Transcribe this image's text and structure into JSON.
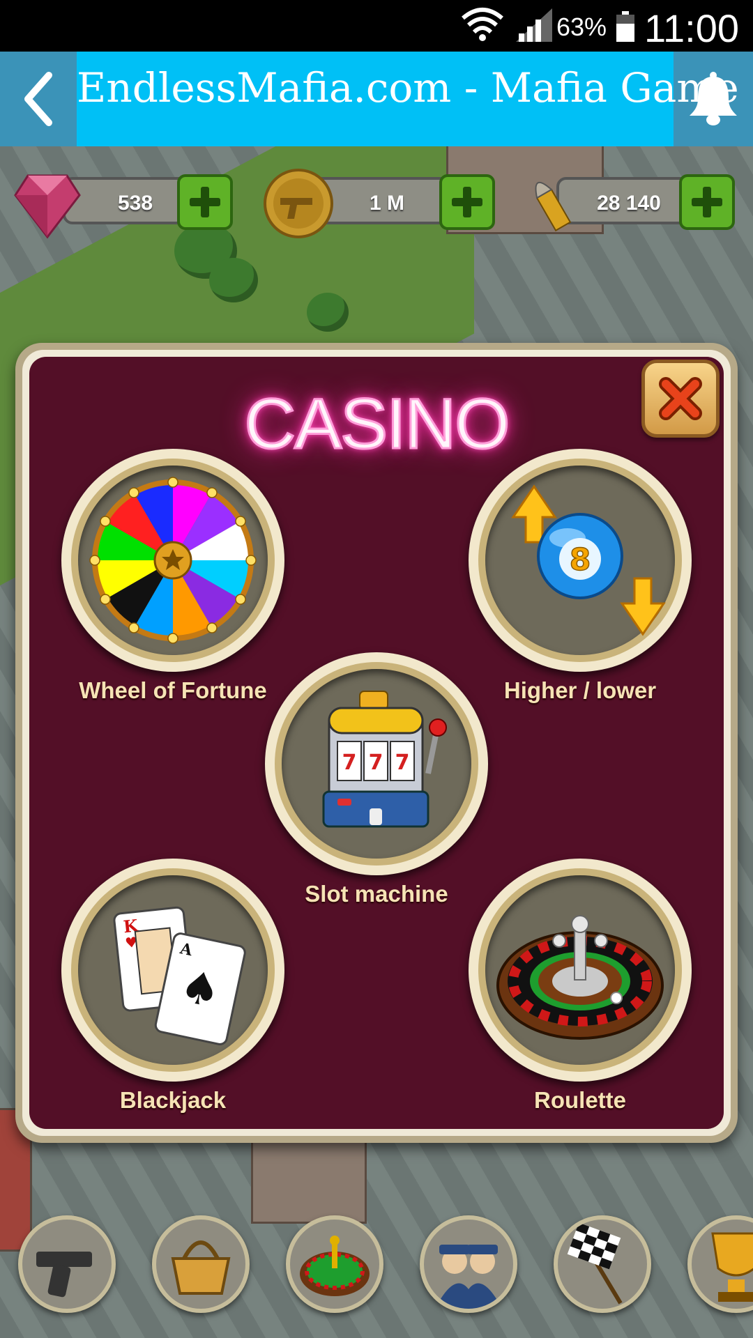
{
  "status_bar": {
    "battery": "63%",
    "time": "11:00"
  },
  "app_bar": {
    "title": "EndlessMafia.com - Mafia Game"
  },
  "resources": {
    "gems": "538",
    "cash": "1 M",
    "bullets": "28 140"
  },
  "casino": {
    "title": "CASINO",
    "games": {
      "wheel": "Wheel of Fortune",
      "higher_lower": "Higher / lower",
      "slot": "Slot machine",
      "blackjack": "Blackjack",
      "roulette": "Roulette"
    }
  },
  "colors": {
    "panel": "#530f27",
    "app_bar": "#00c0f6",
    "label": "#f6e3b5",
    "plus": "#5fb227"
  },
  "icons": [
    "wifi-icon",
    "signal-icon",
    "battery-icon",
    "back-icon",
    "bell-icon",
    "gem-icon",
    "coin-icon",
    "bullet-icon",
    "close-icon",
    "wheel-icon",
    "ball-icon",
    "slot-icon",
    "cards-icon",
    "roulette-icon"
  ]
}
